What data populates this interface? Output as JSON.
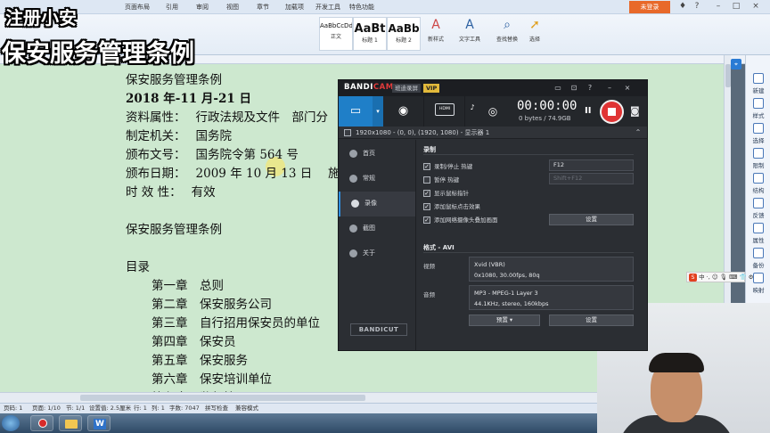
{
  "caption": {
    "line1": "注册小安",
    "line2": "保安服务管理条例"
  },
  "ribbon": {
    "tabs": [
      "页面布局",
      "引用",
      "审阅",
      "视图",
      "章节",
      "加载项",
      "开发工具",
      "特色功能"
    ],
    "login_label": "未登录",
    "styles": [
      {
        "sample": "AaBbCcDd",
        "name": "正文"
      },
      {
        "sample": "AaBt",
        "name": "标题 1"
      },
      {
        "sample": "AaBb",
        "name": "标题 2"
      }
    ],
    "tools": {
      "new_style": "新样式",
      "text_tool": "文字工具",
      "find_replace": "查找替换",
      "select": "选择"
    }
  },
  "document": {
    "lines": [
      {
        "text": "保安服务管理条例",
        "bold": false
      },
      {
        "text": "2018 年-11 月-21 日",
        "bold": true
      },
      {
        "text": "资料属性：　 行政法规及文件　部门分",
        "bold": false
      },
      {
        "text": "制定机关：　 国务院",
        "bold": false
      },
      {
        "text": "颁布文号：　 国务院令第 564 号",
        "bold": false
      },
      {
        "text": "颁布日期：　 2009 年 10 月 13 日　  施",
        "bold": false
      },
      {
        "text": "时  效  性：　 有效",
        "bold": false
      },
      {
        "text": "保安服务管理条例",
        "bold": false
      },
      {
        "text": "目录",
        "bold": false
      },
      {
        "text": "第一章　总则",
        "bold": false
      },
      {
        "text": "第二章　保安服务公司",
        "bold": false
      },
      {
        "text": "第三章　自行招用保安员的单位",
        "bold": false
      },
      {
        "text": "第四章　保安员",
        "bold": false
      },
      {
        "text": "第五章　保安服务",
        "bold": false
      },
      {
        "text": "第六章　保安培训单位",
        "bold": false
      },
      {
        "text": "第七章　监督管理",
        "bold": false
      }
    ]
  },
  "task_pane": {
    "items": [
      "新建",
      "样式",
      "选择",
      "限制",
      "结构",
      "反馈",
      "属性",
      "备份",
      "映射"
    ]
  },
  "ime": {
    "label": "中 ·, ☺ 🎙 ⌨ 👕 ⚙"
  },
  "status_bar": {
    "page": "页码: 1",
    "pages": "页面: 1/10",
    "section": "节: 1/1",
    "setting": "设置值: 2.5厘米",
    "row": "行: 1",
    "col": "列: 1",
    "words": "字数: 7047",
    "spell": "拼写检查",
    "compat": "兼容模式"
  },
  "bandicam": {
    "logo_main": "BANDI",
    "logo_accent": "CAM",
    "promo": "班迪录屏",
    "vip": "VIP",
    "hdmi_label": "HDMI",
    "timer": "00:00:00",
    "size": "0 bytes / 74.9GB",
    "target": "1920x1080 - (0, 0), (1920, 1080) - 显示器 1",
    "nav": [
      "首页",
      "常规",
      "录像",
      "截图",
      "关于"
    ],
    "bandicut": "BANDICUT",
    "record_section": "录制",
    "options": [
      {
        "label": "录制/停止 热键",
        "checked": true
      },
      {
        "label": "暂停 热键",
        "checked": false
      },
      {
        "label": "显示鼠标指针",
        "checked": true
      },
      {
        "label": "添加鼠标点击效果",
        "checked": true
      },
      {
        "label": "添加网络摄像头叠加画面",
        "checked": true
      }
    ],
    "hotkey_record": "F12",
    "hotkey_pause": "Shift+F12",
    "settings_label": "设置",
    "format_section": "格式 - AVI",
    "video_label": "视频",
    "video_codec": "Xvid (VBR)",
    "video_detail": "0x1080, 30.00fps, 80q",
    "audio_label": "音频",
    "audio_codec": "MP3 - MPEG-1 Layer 3",
    "audio_detail": "44.1KHz, stereo, 160kbps",
    "preset_label": "预置",
    "settings2_label": "设置"
  }
}
